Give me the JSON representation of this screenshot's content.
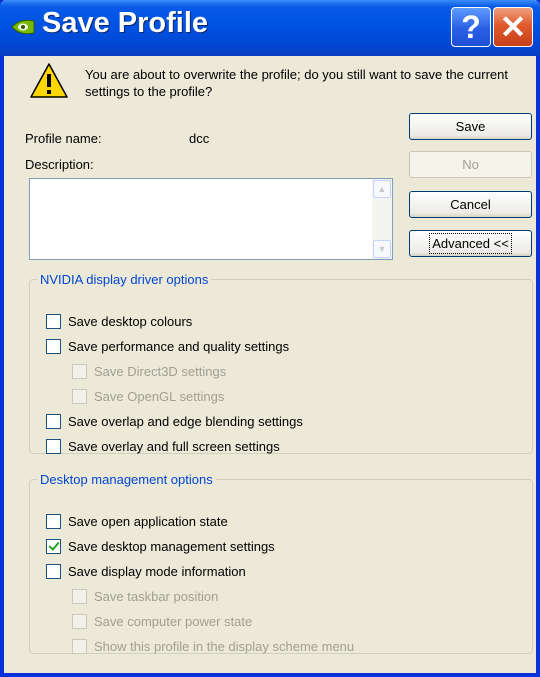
{
  "window": {
    "title": "Save Profile",
    "help_glyph": "?",
    "close_glyph": "✕"
  },
  "message": "You are about to overwrite the profile; do you still want to save the current settings to the profile?",
  "profile": {
    "name_label": "Profile name:",
    "name_value": "dcc",
    "description_label": "Description:",
    "description_value": ""
  },
  "buttons": {
    "save": "Save",
    "no": "No",
    "cancel": "Cancel",
    "advanced": "Advanced <<"
  },
  "nvidia_group": {
    "legend": "NVIDIA display driver options",
    "options": [
      {
        "label": "Save desktop colours",
        "checked": false,
        "enabled": true
      },
      {
        "label": "Save performance and quality settings",
        "checked": false,
        "enabled": true
      },
      {
        "label": "Save Direct3D settings",
        "checked": false,
        "enabled": false
      },
      {
        "label": "Save OpenGL settings",
        "checked": false,
        "enabled": false
      },
      {
        "label": "Save overlap and edge blending settings",
        "checked": false,
        "enabled": true
      },
      {
        "label": "Save overlay and full screen settings",
        "checked": false,
        "enabled": true
      }
    ]
  },
  "desktop_group": {
    "legend": "Desktop management options",
    "options": [
      {
        "label": "Save open application state",
        "checked": false,
        "enabled": true
      },
      {
        "label": "Save desktop management settings",
        "checked": true,
        "enabled": true
      },
      {
        "label": "Save display mode information",
        "checked": false,
        "enabled": true
      },
      {
        "label": "Save taskbar position",
        "checked": false,
        "enabled": false
      },
      {
        "label": "Save computer power state",
        "checked": false,
        "enabled": false
      },
      {
        "label": "Show this profile in the display scheme menu",
        "checked": false,
        "enabled": false
      }
    ]
  },
  "colors": {
    "titlebar": "#0054e3",
    "dialog": "#ece9d8",
    "group_legend": "#0046d5",
    "disabled_text": "#a19f94"
  }
}
